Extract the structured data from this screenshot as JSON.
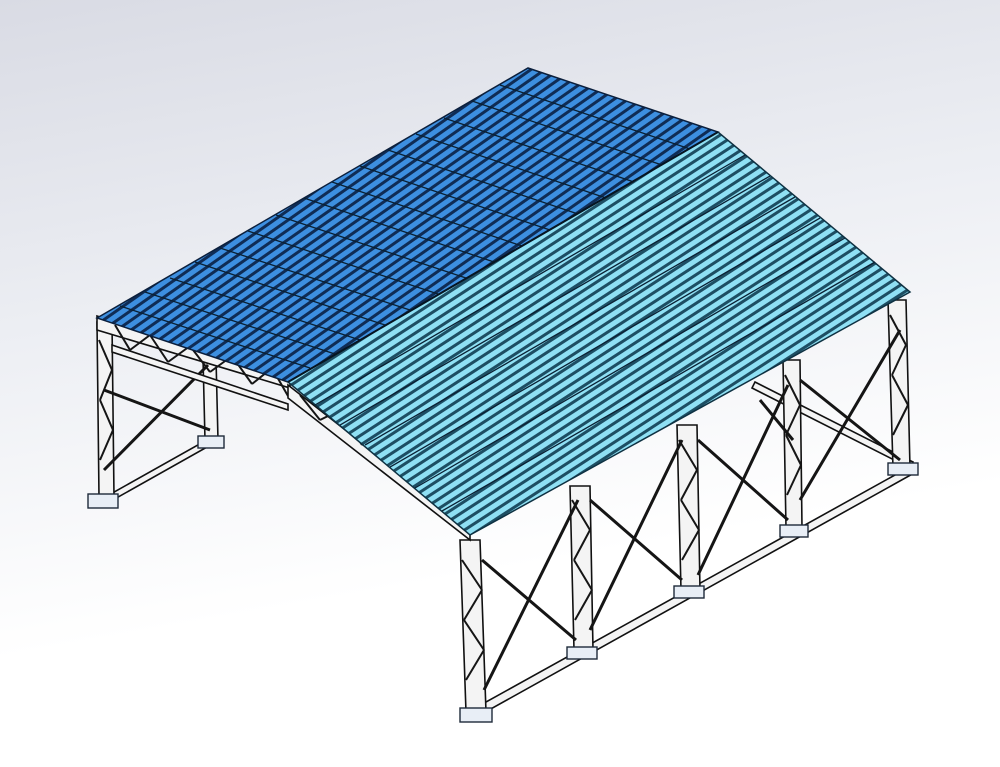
{
  "scene": {
    "subject": "steel-frame-shed-with-gable-roof",
    "view": "isometric"
  },
  "colors": {
    "background_top": "#d9dbe4",
    "background_bottom": "#ffffff",
    "roof_left_panel": "#3d8fe0",
    "roof_left_rib": "#0f2c55",
    "roof_right_panel": "#8fe0f4",
    "roof_right_rib": "#1d4e63",
    "steel_fill": "#f4f4f4",
    "steel_edge": "#111111",
    "base_plate": "#e8eef6",
    "base_plate_edge": "#1e2a3a"
  }
}
